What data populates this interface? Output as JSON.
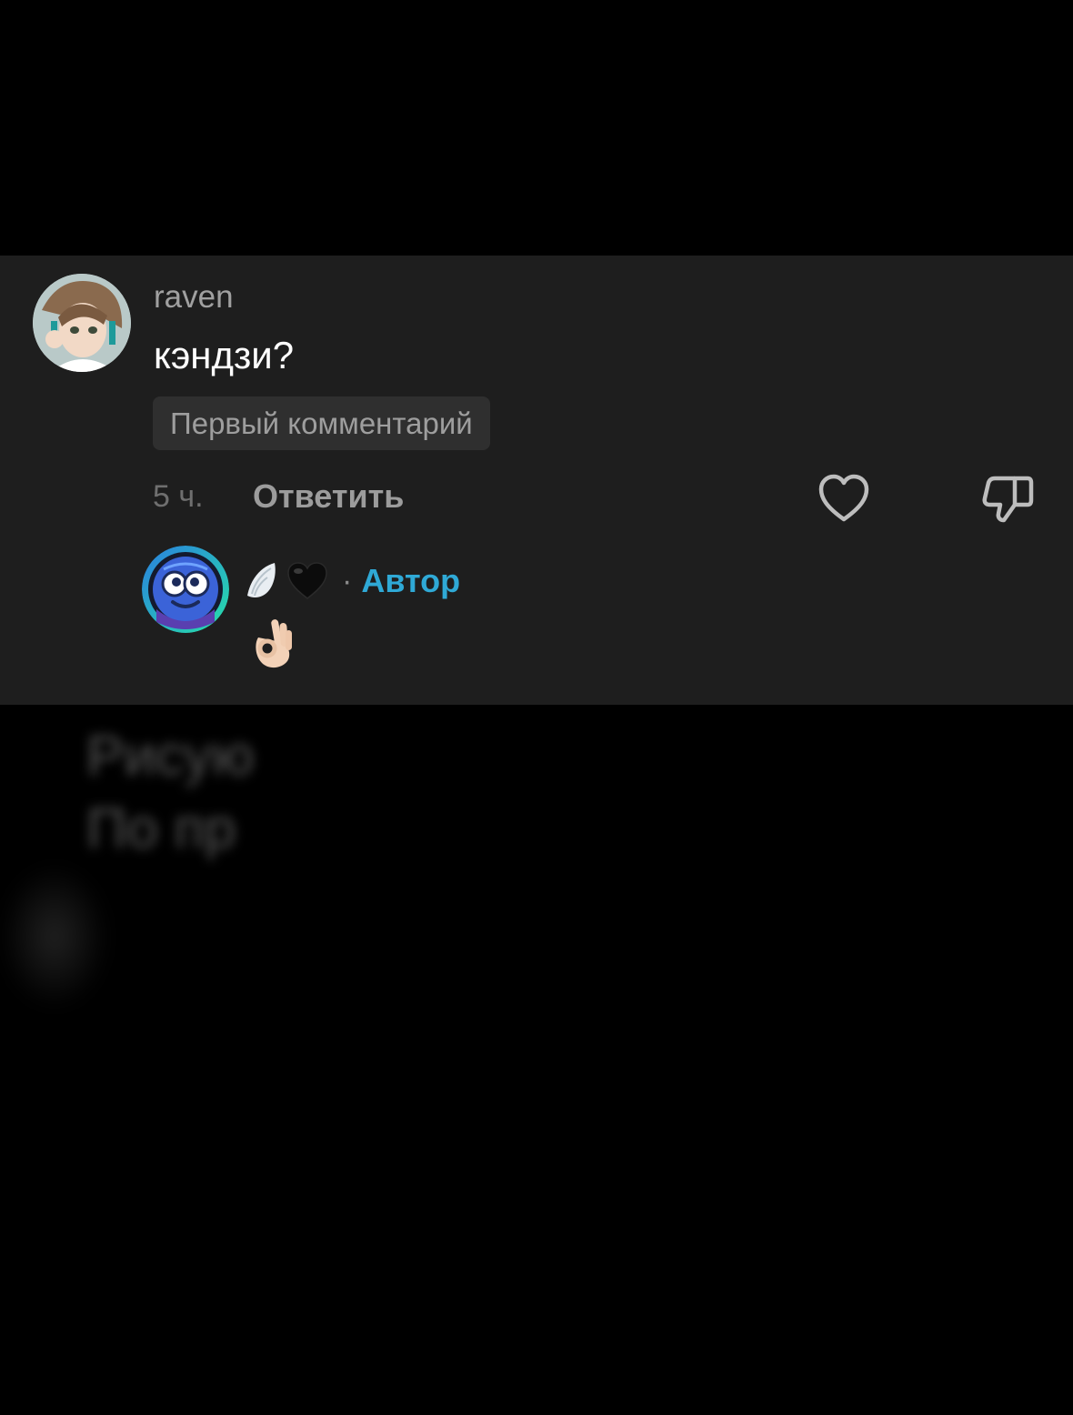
{
  "comment": {
    "username": "raven",
    "text": "кэндзи?",
    "badge": "Первый комментарий",
    "time": "5 ч.",
    "reply_label": "Ответить"
  },
  "reply": {
    "name_icons": [
      "wing-emoji",
      "black-heart-emoji"
    ],
    "separator": "·",
    "author_label": "Автор",
    "text_icon": "ok-hand-emoji"
  },
  "background": {
    "blurred_lines": [
      "Рисую",
      "По пр"
    ]
  },
  "colors": {
    "background": "#000000",
    "card": "#1e1e1e",
    "badge": "#2f2f2f",
    "author_accent": "#2fa9d6",
    "username": "#a0a0a0"
  }
}
